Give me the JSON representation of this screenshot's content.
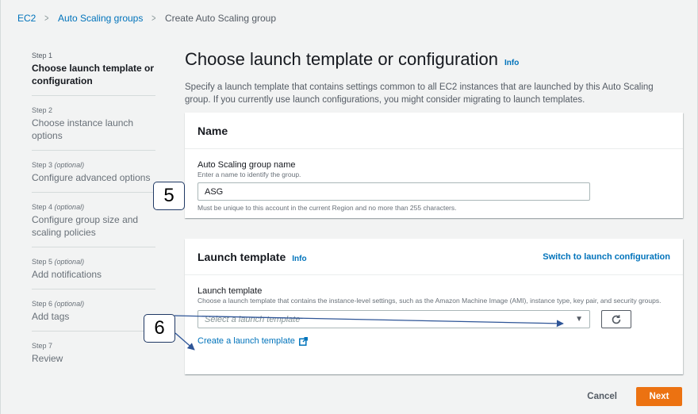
{
  "breadcrumb": {
    "items": [
      "EC2",
      "Auto Scaling groups"
    ],
    "current": "Create Auto Scaling group"
  },
  "steps": [
    {
      "num": "Step 1",
      "optional": "",
      "title": "Choose launch template or configuration",
      "active": true
    },
    {
      "num": "Step 2",
      "optional": "",
      "title": "Choose instance launch options",
      "active": false
    },
    {
      "num": "Step 3",
      "optional": "(optional)",
      "title": "Configure advanced options",
      "active": false
    },
    {
      "num": "Step 4",
      "optional": "(optional)",
      "title": "Configure group size and scaling policies",
      "active": false
    },
    {
      "num": "Step 5",
      "optional": "(optional)",
      "title": "Add notifications",
      "active": false
    },
    {
      "num": "Step 6",
      "optional": "(optional)",
      "title": "Add tags",
      "active": false
    },
    {
      "num": "Step 7",
      "optional": "",
      "title": "Review",
      "active": false
    }
  ],
  "page": {
    "title": "Choose launch template or configuration",
    "info": "Info",
    "description": "Specify a launch template that contains settings common to all EC2 instances that are launched by this Auto Scaling group. If you currently use launch configurations, you might consider migrating to launch templates."
  },
  "name_panel": {
    "title": "Name",
    "field_label": "Auto Scaling group name",
    "field_desc": "Enter a name to identify the group.",
    "value": "ASG",
    "constraint": "Must be unique to this account in the current Region and no more than 255 characters."
  },
  "launch_panel": {
    "title": "Launch template",
    "info": "Info",
    "switch_link": "Switch to launch configuration",
    "field_label": "Launch template",
    "field_desc": "Choose a launch template that contains the instance-level settings, such as the Amazon Machine Image (AMI), instance type, key pair, and security groups.",
    "placeholder": "Select a launch template",
    "create_link": "Create a launch template"
  },
  "footer": {
    "cancel": "Cancel",
    "next": "Next"
  },
  "callouts": {
    "five": "5",
    "six": "6"
  },
  "colors": {
    "link": "#0073bb",
    "primary_button": "#ec7211",
    "background": "#f2f3f3",
    "callout_border": "#1f3864"
  }
}
